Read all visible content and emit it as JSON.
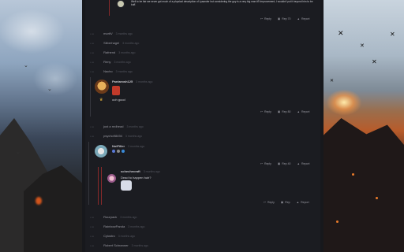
{
  "thread": {
    "top_comment": {
      "text": "Well to be fair we never got much of a physical description of Lysander but considering the guy is a very big man it'll improvement, I wouldn't put it beyond him to be buff.",
      "actions": {
        "reply": "Reply",
        "rep": "Rep 70",
        "report": "Report"
      }
    },
    "collapsed_users_1": [
      {
        "name": "mortiV",
        "time": "3 months ago"
      },
      {
        "name": "Silberhagel",
        "time": "3 months ago"
      },
      {
        "name": "Rafnend",
        "time": "3 months ago"
      },
      {
        "name": "Reny",
        "time": "3 months ago"
      },
      {
        "name": "Nacho",
        "time": "3 months ago"
      }
    ],
    "comment_2": {
      "user": "Pantarosh125",
      "time": "3 months ago",
      "text": "ooh good",
      "actions": {
        "reply": "Reply",
        "rep": "Rep 80",
        "report": "Report"
      }
    },
    "collapsed_users_2": [
      {
        "name": "just a redhead",
        "time": "3 months ago"
      },
      {
        "name": "psycho98494",
        "time": "3 months ago"
      }
    ],
    "comment_3": {
      "user": "NoiFiller",
      "time": "3 months ago",
      "actions": {
        "reply": "Reply",
        "rep": "Rep 40",
        "report": "Report"
      }
    },
    "comment_4": {
      "user": "schechecraft",
      "time": "3 months ago",
      "text": "Dead to happen huh?",
      "actions": {
        "reply": "Reply",
        "rep": "Rep",
        "report": "Report"
      }
    },
    "collapsed_users_3": [
      {
        "name": "Rourpack",
        "time": "3 months ago"
      },
      {
        "name": "RainbowPanda",
        "time": "3 months ago"
      },
      {
        "name": "Cylostro",
        "time": "3 months ago"
      },
      {
        "name": "Robert Schranner",
        "time": "3 months ago"
      }
    ]
  },
  "colors": {
    "panel": "#1b1c21",
    "accent_red": "#8a2a2a",
    "text_muted": "#9a9aa3"
  }
}
